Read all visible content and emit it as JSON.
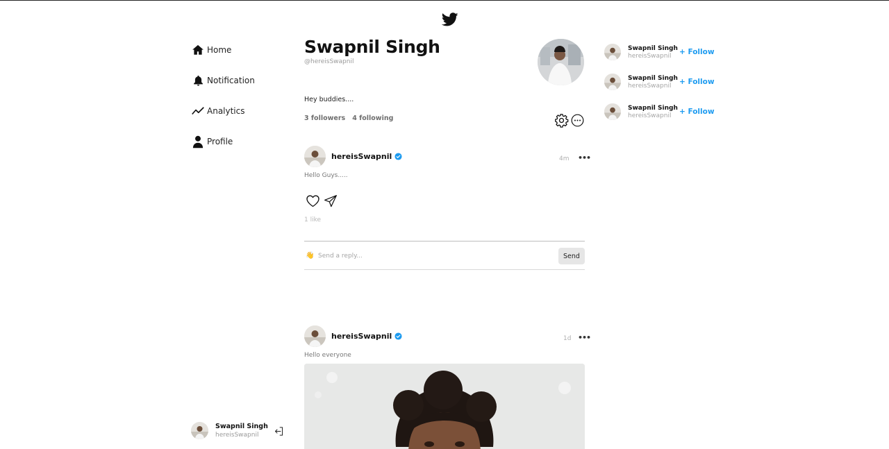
{
  "brand": {
    "logo_icon": "twitter-bird-icon"
  },
  "nav": {
    "items": [
      {
        "label": "Home",
        "icon": "home-icon"
      },
      {
        "label": "Notification",
        "icon": "bell-icon"
      },
      {
        "label": "Analytics",
        "icon": "trend-icon"
      },
      {
        "label": "Profile",
        "icon": "person-icon"
      }
    ]
  },
  "current_user": {
    "name": "Swapnil Singh",
    "handle": "hereisSwapnil"
  },
  "profile": {
    "name": "Swapnil Singh",
    "handle": "@hereisSwapnil",
    "bio": "Hey buddies....",
    "followers": "3 followers",
    "following": "4 following"
  },
  "posts": [
    {
      "user": "hereisSwapnil",
      "time": "4m",
      "text": "Hello Guys.....",
      "likes": "1 like",
      "reply_placeholder": "Send a reply...",
      "reply_emoji": "👋",
      "send_label": "Send"
    },
    {
      "user": "hereisSwapnil",
      "time": "1d",
      "text": "Hello everyone"
    }
  ],
  "suggestions": [
    {
      "name": "Swapnil Singh",
      "handle": "hereisSwapnil",
      "follow_label": "+ Follow"
    },
    {
      "name": "Swapnil Singh",
      "handle": "hereisSwapnil",
      "follow_label": "+ Follow"
    },
    {
      "name": "Swapnil Singh",
      "handle": "hereisSwapnil",
      "follow_label": "+ Follow"
    }
  ],
  "colors": {
    "accent": "#1d9bf0",
    "verified": "#1d9bf0"
  }
}
